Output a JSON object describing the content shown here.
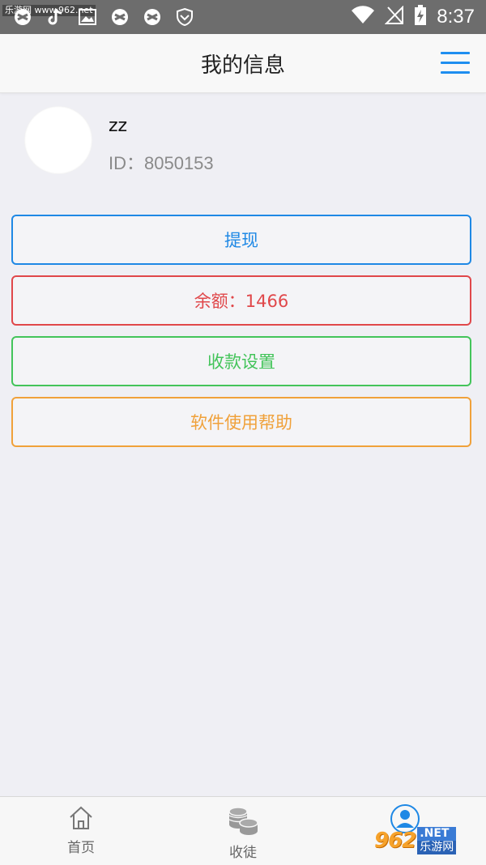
{
  "status_bar": {
    "watermark": "乐游网 www.962.net",
    "time": "8:37"
  },
  "header": {
    "title": "我的信息",
    "menu_icon": "hamburger-menu-icon"
  },
  "profile": {
    "username": "zz",
    "id_text": "ID：8050153"
  },
  "actions": {
    "withdraw": "提现",
    "balance": "余额：1466",
    "payment_settings": "收款设置",
    "help": "软件使用帮助"
  },
  "colors": {
    "withdraw": "#1e88e5",
    "balance": "#e0474a",
    "payment_settings": "#43c45a",
    "help": "#f0a13a"
  },
  "bottom_nav": {
    "home": "首页",
    "apprentice": "收徒"
  },
  "watermark_bottom": {
    "logo": "962",
    "net": ".NET",
    "cn": "乐游网"
  }
}
